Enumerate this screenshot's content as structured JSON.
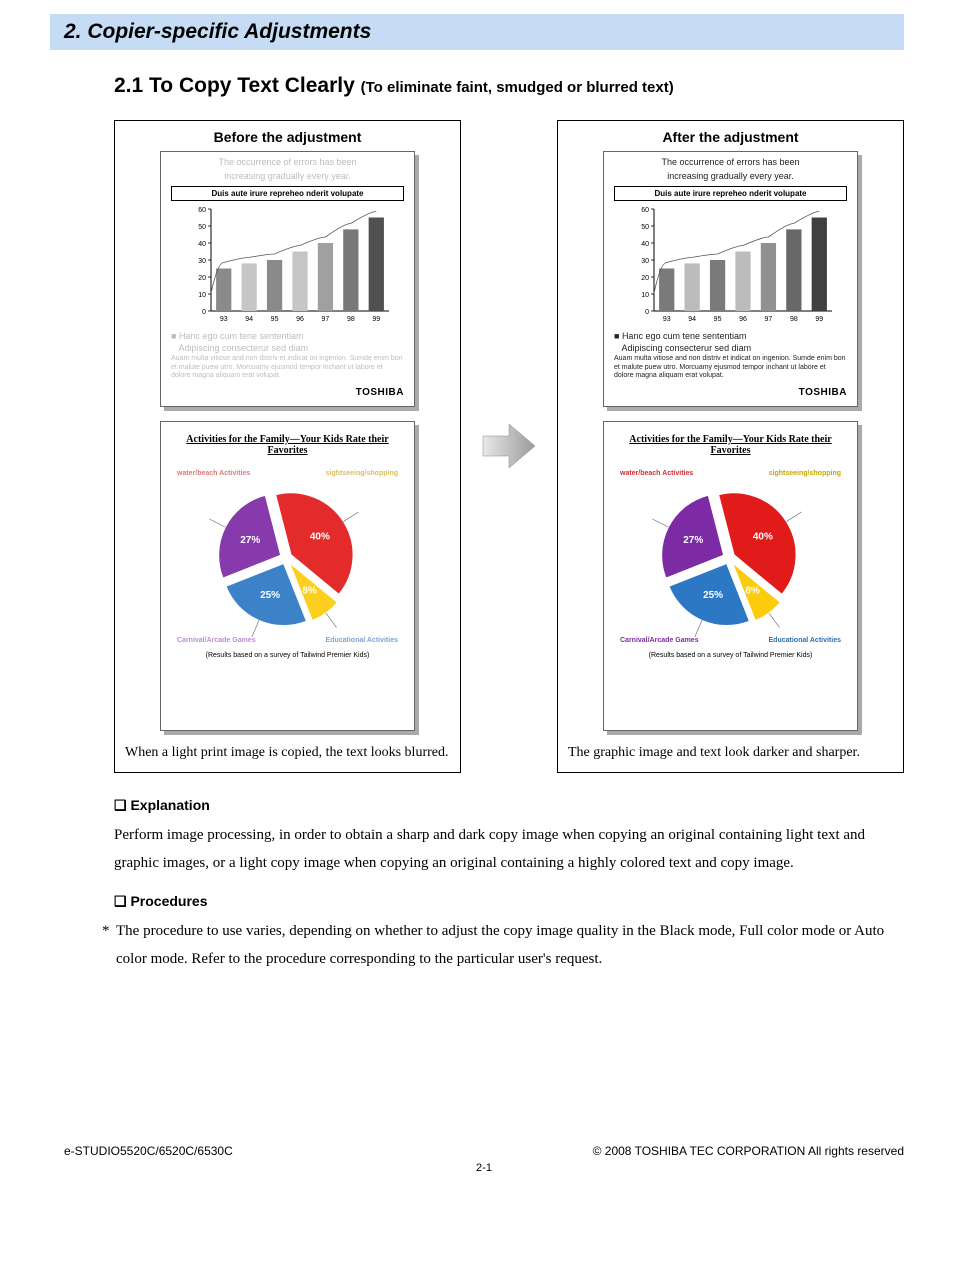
{
  "chapter_title": "2. Copier-specific Adjustments",
  "section_title_main": "2.1 To Copy Text Clearly ",
  "section_title_sub": "(To eliminate faint, smudged or blurred text)",
  "before": {
    "label": "Before the adjustment",
    "caption": "When a light print image is copied, the text looks blurred."
  },
  "after": {
    "label": "After the adjustment",
    "caption": "The graphic image and text look darker and sharper."
  },
  "sample": {
    "top_line1": "The occurrence of errors has been",
    "top_line2": "increasing gradually every year.",
    "box_text": "Duis aute irure repreheo nderit volupate",
    "legend1": "Hanc ego cum tene sententiam",
    "legend2": "Adipiscing consecterur sed diam",
    "para": "Auam multa vitiose and non distriv et indicat on ingenion. Sumde enim bon et malute puew utro. Morcuamy ejusmod tempor inchant ut labore et dolore magna aliquam erat volupat.",
    "brand": "TOSHIBA"
  },
  "sample2": {
    "title": "Activities for the Family—Your Kids Rate their Favorites",
    "labels": {
      "water": "water/beach Activities",
      "sight": "sightseeing/shopping",
      "edu": "Educational Activities",
      "carn": "Carnival/Arcade Games"
    },
    "pct": {
      "p40": "40%",
      "p8": "8%",
      "p25": "25%",
      "p27": "27%"
    },
    "foot": "(Results based on a survey of Tailwind Premier Kids)"
  },
  "chart_data": {
    "type": "bar",
    "categories": [
      "93",
      "94",
      "95",
      "96",
      "97",
      "98",
      "99"
    ],
    "values": [
      25,
      28,
      30,
      35,
      40,
      48,
      55
    ],
    "title": "Duis aute irure repreheo nderit volupate",
    "xlabel": "",
    "ylabel": "",
    "ylim": [
      0,
      60
    ],
    "yticks": [
      0,
      10,
      20,
      30,
      40,
      50,
      60
    ]
  },
  "pie_chart_data": {
    "type": "pie",
    "title": "Activities for the Family—Your Kids Rate their Favorites",
    "series": [
      {
        "name": "water/beach Activities",
        "value": 40,
        "color": "#e11a1a"
      },
      {
        "name": "sightseeing/shopping",
        "value": 8,
        "color": "#fccb0b"
      },
      {
        "name": "Educational Activities",
        "value": 25,
        "color": "#2c78c5"
      },
      {
        "name": "Carnival/Arcade Games",
        "value": 27,
        "color": "#7d2aa5"
      }
    ]
  },
  "explanation": {
    "head": "Explanation",
    "body": "Perform image processing, in order to obtain a sharp and dark copy image when copying an original containing light text and graphic images, or a light copy image when copying an original containing a highly colored text and copy image."
  },
  "procedures": {
    "head": "Procedures",
    "note": "The procedure to use varies, depending on whether to adjust the copy image quality in the Black mode, Full color mode or Auto color mode.  Refer to the procedure corresponding to the particular user's request."
  },
  "footer": {
    "model": "e-STUDIO5520C/6520C/6530C",
    "copyright": "© 2008 TOSHIBA TEC CORPORATION All rights reserved",
    "page": "2-1"
  }
}
